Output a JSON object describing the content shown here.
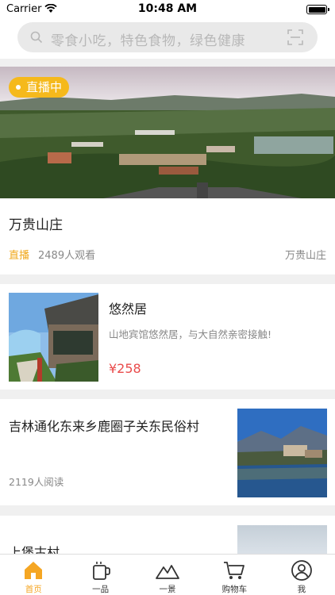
{
  "status": {
    "carrier": "Carrier",
    "time": "10:48 AM"
  },
  "search": {
    "placeholder": "零食小吃，特色食物，绿色健康"
  },
  "live": {
    "badge": "直播中",
    "title": "万贵山庄",
    "tag": "直播",
    "views": "2489人观看",
    "location": "万贵山庄"
  },
  "hotel": {
    "title": "悠然居",
    "description": "山地宾馆悠然居，与大自然亲密接触!",
    "price": "¥258"
  },
  "article": {
    "title": "吉林通化东来乡鹿圈子关东民俗村",
    "reads": "2119人阅读"
  },
  "article2": {
    "title": "上堡古村"
  },
  "tabs": [
    {
      "label": "首页",
      "icon": "home-icon",
      "active": true
    },
    {
      "label": "一品",
      "icon": "cup-icon",
      "active": false
    },
    {
      "label": "一景",
      "icon": "mountain-icon",
      "active": false
    },
    {
      "label": "购物车",
      "icon": "cart-icon",
      "active": false
    },
    {
      "label": "我",
      "icon": "user-icon",
      "active": false
    }
  ],
  "colors": {
    "accent": "#f5a623",
    "badge": "#f5b91c",
    "price": "#e94b4b",
    "live_tag": "#f0a81c"
  }
}
